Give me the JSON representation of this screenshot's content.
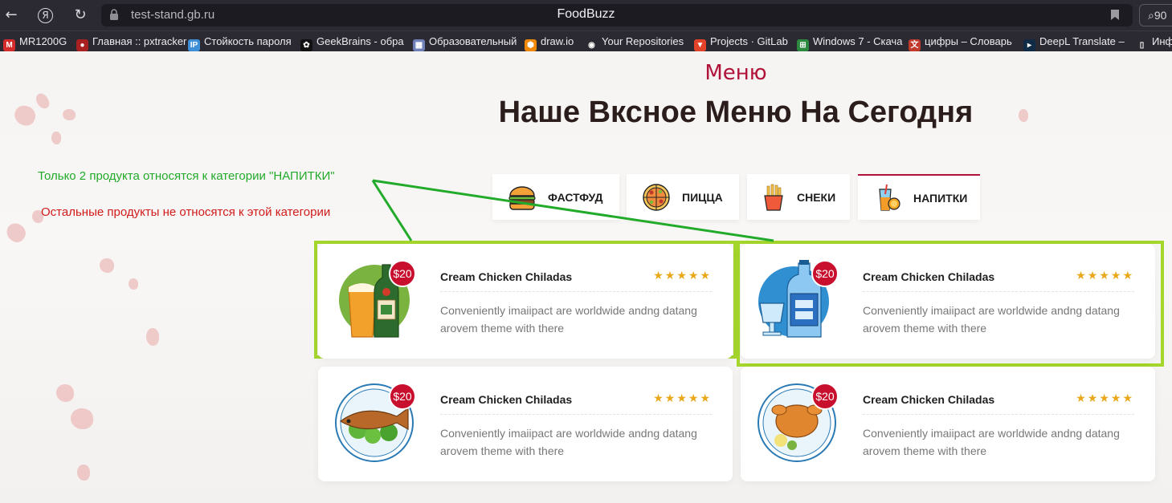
{
  "browser": {
    "url": "test-stand.gb.ru",
    "tab_title": "FoodBuzz",
    "search_label": "90"
  },
  "bookmarks": [
    {
      "label": "MR1200G",
      "icon": "mr1200g-favicon",
      "color": "#d62b2b",
      "glyph": "M"
    },
    {
      "label": "Главная :: pxtracker",
      "icon": "pxtracker-favicon",
      "color": "#a82020",
      "glyph": "●"
    },
    {
      "label": "Стойкость пароля",
      "icon": "ip-favicon",
      "color": "#3d8fd8",
      "glyph": "IP"
    },
    {
      "label": "GeekBrains - обра",
      "icon": "geekbrains-favicon",
      "color": "#111111",
      "glyph": "✿"
    },
    {
      "label": "Образовательный",
      "icon": "education-favicon",
      "color": "#6f7fb8",
      "glyph": "▦"
    },
    {
      "label": "draw.io",
      "icon": "drawio-favicon",
      "color": "#f08705",
      "glyph": "⬢"
    },
    {
      "label": "Your Repositories",
      "icon": "github-favicon",
      "color": "#2b2a33",
      "glyph": "◉"
    },
    {
      "label": "Projects · GitLab",
      "icon": "gitlab-favicon",
      "color": "#e24329",
      "glyph": "▼"
    },
    {
      "label": "Windows 7 - Скача",
      "icon": "windows-favicon",
      "color": "#2b8a3e",
      "glyph": "⊞"
    },
    {
      "label": "цифры – Словарь",
      "icon": "dictionary-favicon",
      "color": "#c0392b",
      "glyph": "文"
    },
    {
      "label": "DeepL Translate –",
      "icon": "deepl-favicon",
      "color": "#0f2b46",
      "glyph": "▸"
    },
    {
      "label": "Инф",
      "icon": "document-favicon",
      "color": "#2b2a33",
      "glyph": "▯"
    }
  ],
  "section": {
    "subtitle": "Меню",
    "heading": "Наше Вксное Меню На Сегодня"
  },
  "tabs": [
    {
      "label": "ФАСТФУД",
      "icon": "burger-icon"
    },
    {
      "label": "ПИЦЦА",
      "icon": "pizza-icon"
    },
    {
      "label": "СНЕКИ",
      "icon": "fries-icon"
    },
    {
      "label": "НАПИТКИ",
      "icon": "drinks-icon",
      "active": true
    }
  ],
  "cards": [
    {
      "name": "Cream Chicken Chiladas",
      "price": "$20",
      "rating": 5,
      "stars": "★★★★★",
      "desc": "Conveniently imaiipact are worldwide andng datang arovem theme with there",
      "image": "beer-bottle-icon",
      "highlighted": true
    },
    {
      "name": "Cream Chicken Chiladas",
      "price": "$20",
      "rating": 5,
      "stars": "★★★★★",
      "desc": "Conveniently imaiipact are worldwide andng datang arovem theme with there",
      "image": "vodka-bottle-icon",
      "highlighted": true
    },
    {
      "name": "Cream Chicken Chiladas",
      "price": "$20",
      "rating": 5,
      "stars": "★★★★★",
      "desc": "Conveniently imaiipact are worldwide andng datang arovem theme with there",
      "image": "fried-fish-plate-icon",
      "highlighted": false
    },
    {
      "name": "Cream Chicken Chiladas",
      "price": "$20",
      "rating": 5,
      "stars": "★★★★★",
      "desc": "Conveniently imaiipact are worldwide andng datang arovem theme with there",
      "image": "roast-chicken-plate-icon",
      "highlighted": false
    }
  ],
  "annotations": {
    "green_note": "Только 2 продукта относятся к категории \"НАПИТКИ\"",
    "red_note": "Остальные продукты не относятся к этой категории",
    "green_color": "#22aa2a",
    "red_color": "#d11b1b",
    "highlight_color": "#a4d62c"
  },
  "colors": {
    "accent": "#b0123a",
    "price_badge": "#c8102e",
    "stars": "#e9a81a"
  }
}
